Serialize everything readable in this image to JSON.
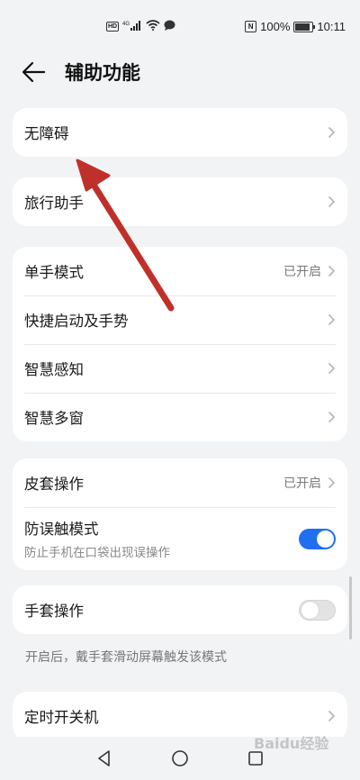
{
  "status_bar": {
    "hd": "HD",
    "signal": "4G",
    "nfc": "N",
    "battery_pct": "100%",
    "battery_level": 1.0,
    "time": "10:11"
  },
  "header": {
    "title": "辅助功能"
  },
  "groups": [
    {
      "items": [
        {
          "label": "无障碍"
        }
      ]
    },
    {
      "items": [
        {
          "label": "旅行助手"
        }
      ]
    },
    {
      "items": [
        {
          "label": "单手模式",
          "value": "已开启"
        },
        {
          "label": "快捷启动及手势"
        },
        {
          "label": "智慧感知"
        },
        {
          "label": "智慧多窗"
        }
      ]
    },
    {
      "items": [
        {
          "label": "皮套操作",
          "value": "已开启"
        },
        {
          "label": "防误触模式",
          "sub": "防止手机在口袋出现误操作",
          "toggle": true
        }
      ]
    },
    {
      "items": [
        {
          "label": "手套操作",
          "toggle": false
        }
      ]
    },
    {
      "items": [
        {
          "label": "定时开关机"
        }
      ]
    }
  ],
  "glove_note": "开启后，戴手套滑动屏幕触发该模式",
  "colors": {
    "accent": "#1f6ff0",
    "annotation_arrow": "#c0302a",
    "background": "#f1f3f5"
  },
  "watermark": "Baidu经验"
}
